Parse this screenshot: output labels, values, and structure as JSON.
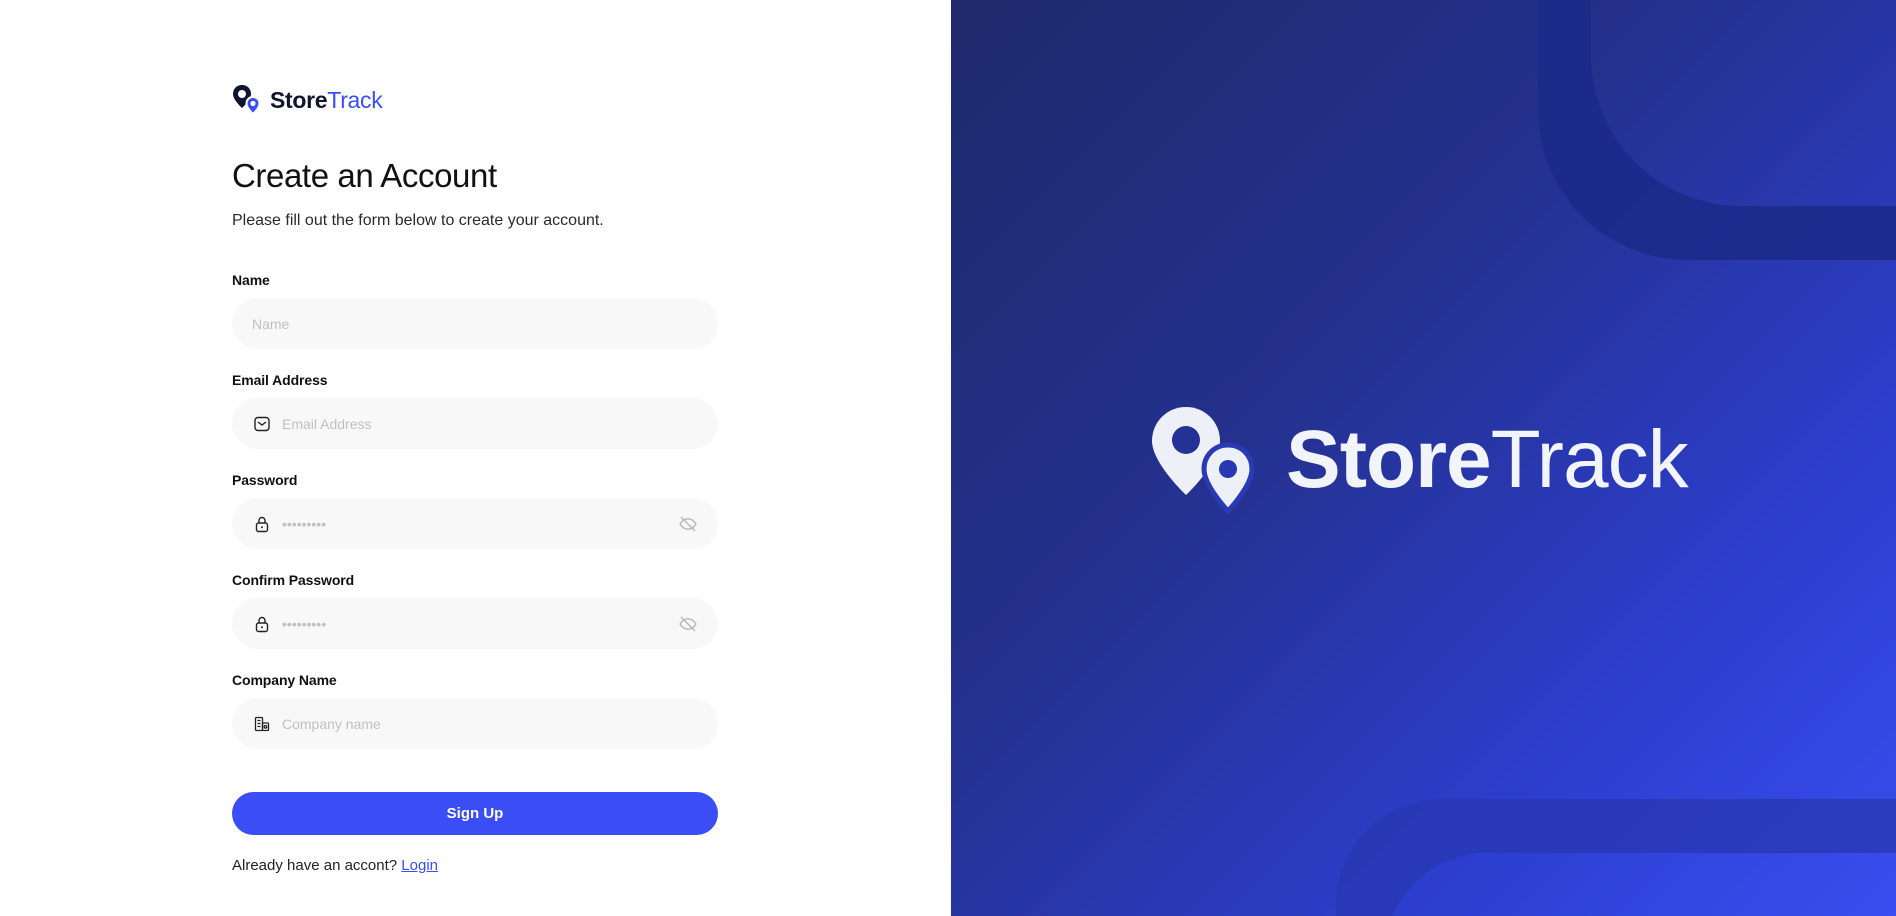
{
  "brand": {
    "part1": "Store",
    "part2": "Track"
  },
  "form": {
    "title": "Create an Account",
    "subtitle": "Please fill out the form below to create your account.",
    "fields": [
      {
        "label": "Name",
        "placeholder": "Name",
        "icon": "none"
      },
      {
        "label": "Email Address",
        "placeholder": "Email Address",
        "icon": "mail-icon"
      },
      {
        "label": "Password",
        "placeholder": "•••••••••",
        "icon": "lock-icon",
        "toggle_icon": "eye-off-icon"
      },
      {
        "label": "Confirm Password",
        "placeholder": "•••••••••",
        "icon": "lock-icon",
        "toggle_icon": "eye-off-icon"
      },
      {
        "label": "Company Name",
        "placeholder": "Company name",
        "icon": "building-icon"
      }
    ],
    "submit_label": "Sign Up",
    "login_prompt": "Already have an accont?",
    "login_link": "Login"
  },
  "hero": {
    "part1": "Store",
    "part2": "Track"
  },
  "colors": {
    "accent": "#3b4ef5",
    "hero_dark": "#1e2a6a",
    "hero_light": "#3a4df0",
    "input_bg": "#f8f8f8"
  }
}
